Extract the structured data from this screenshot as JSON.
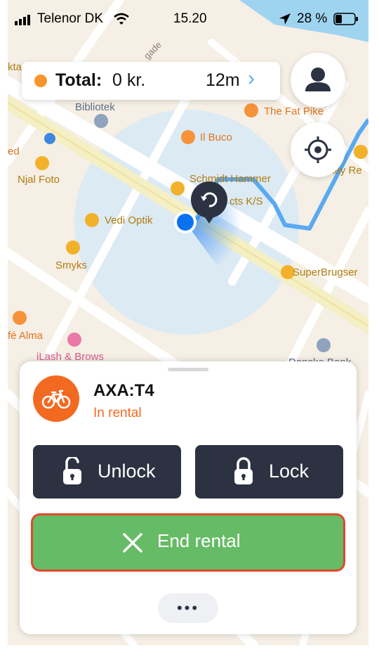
{
  "status_bar": {
    "carrier": "Telenor DK",
    "time": "15.20",
    "battery": "28 %",
    "signal_icon": "signal-bars-icon",
    "wifi_icon": "wifi-icon",
    "location_icon": "location-arrow-icon",
    "battery_icon": "battery-icon"
  },
  "total_pill": {
    "label": "Total:",
    "amount": "0 kr.",
    "duration": "12m",
    "chevron": "›",
    "status_dot_color": "#f7952a"
  },
  "map": {
    "pois": [
      {
        "name": "Bibliotek",
        "icon": "library-icon"
      },
      {
        "name": "The Fat Pike",
        "icon": "restaurant-icon"
      },
      {
        "name": "Il Buco",
        "icon": "restaurant-icon"
      },
      {
        "name": "Njal Foto",
        "icon": "shopping-icon"
      },
      {
        "name": "Vedi Optik",
        "icon": "glasses-icon"
      },
      {
        "name": "Smyks",
        "icon": "shopping-icon"
      },
      {
        "name": "SuperBrugser",
        "icon": "cart-icon"
      },
      {
        "name": "fé Alma",
        "icon": "cafe-icon"
      },
      {
        "name": "iLash & Brows",
        "icon": "beauty-icon"
      },
      {
        "name": "Schmidt Hammer",
        "icon": "shopping-icon"
      },
      {
        "name": "cts K/S",
        "icon": ""
      },
      {
        "name": "ed",
        "icon": ""
      },
      {
        "name": "kta",
        "icon": ""
      },
      {
        "name": "key Re",
        "icon": "bike-icon"
      },
      {
        "name": "Danske Bank",
        "icon": "bank-icon"
      },
      {
        "name": "gade",
        "icon": ""
      }
    ],
    "route_color": "#5aa9f2",
    "user_dot_color": "#0a72f0"
  },
  "sheet": {
    "vehicle_name": "AXA:T4",
    "status": "In rental",
    "accent_color": "#f26a21",
    "unlock_label": "Unlock",
    "lock_label": "Lock",
    "end_label": "End rental",
    "end_color": "#66bb66",
    "more_label": "•••"
  }
}
